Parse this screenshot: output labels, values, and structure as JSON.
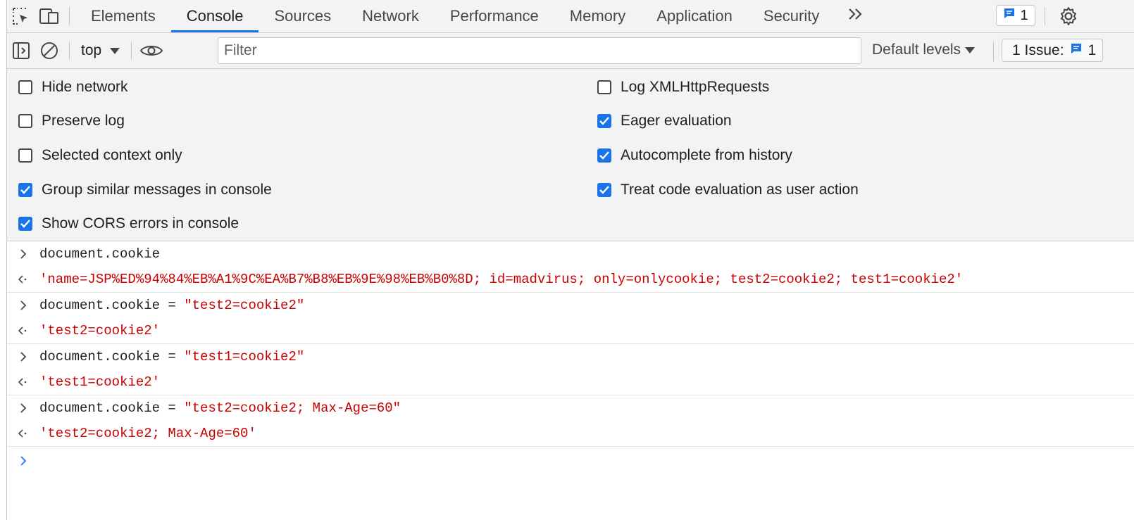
{
  "tabs": [
    "Elements",
    "Console",
    "Sources",
    "Network",
    "Performance",
    "Memory",
    "Application",
    "Security"
  ],
  "tabbar": {
    "issues_count": "1"
  },
  "toolbar": {
    "context": "top",
    "filter_placeholder": "Filter",
    "levels": "Default levels",
    "issues_label": "1 Issue:",
    "issues_count": "1"
  },
  "settings": {
    "left": [
      {
        "label": "Hide network",
        "checked": false
      },
      {
        "label": "Preserve log",
        "checked": false
      },
      {
        "label": "Selected context only",
        "checked": false
      },
      {
        "label": "Group similar messages in console",
        "checked": true
      },
      {
        "label": "Show CORS errors in console",
        "checked": true
      }
    ],
    "right": [
      {
        "label": "Log XMLHttpRequests",
        "checked": false
      },
      {
        "label": "Eager evaluation",
        "checked": true
      },
      {
        "label": "Autocomplete from history",
        "checked": true
      },
      {
        "label": "Treat code evaluation as user action",
        "checked": true
      }
    ]
  },
  "console": [
    {
      "input": "document.cookie",
      "input_str": "",
      "output": "'name=JSP%ED%94%84%EB%A1%9C%EA%B7%B8%EB%9E%98%EB%B0%8D; id=madvirus; only=onlycookie; test2=cookie2; test1=cookie2'"
    },
    {
      "input": "document.cookie = ",
      "input_str": "\"test2=cookie2\"",
      "output": "'test2=cookie2'"
    },
    {
      "input": "document.cookie = ",
      "input_str": "\"test1=cookie2\"",
      "output": "'test1=cookie2'"
    },
    {
      "input": "document.cookie = ",
      "input_str": "\"test2=cookie2; Max-Age=60\"",
      "output": "'test2=cookie2; Max-Age=60'"
    }
  ],
  "colors": {
    "accent": "#1a73e8",
    "string": "#c80000",
    "panel": "#f1f3f4"
  }
}
